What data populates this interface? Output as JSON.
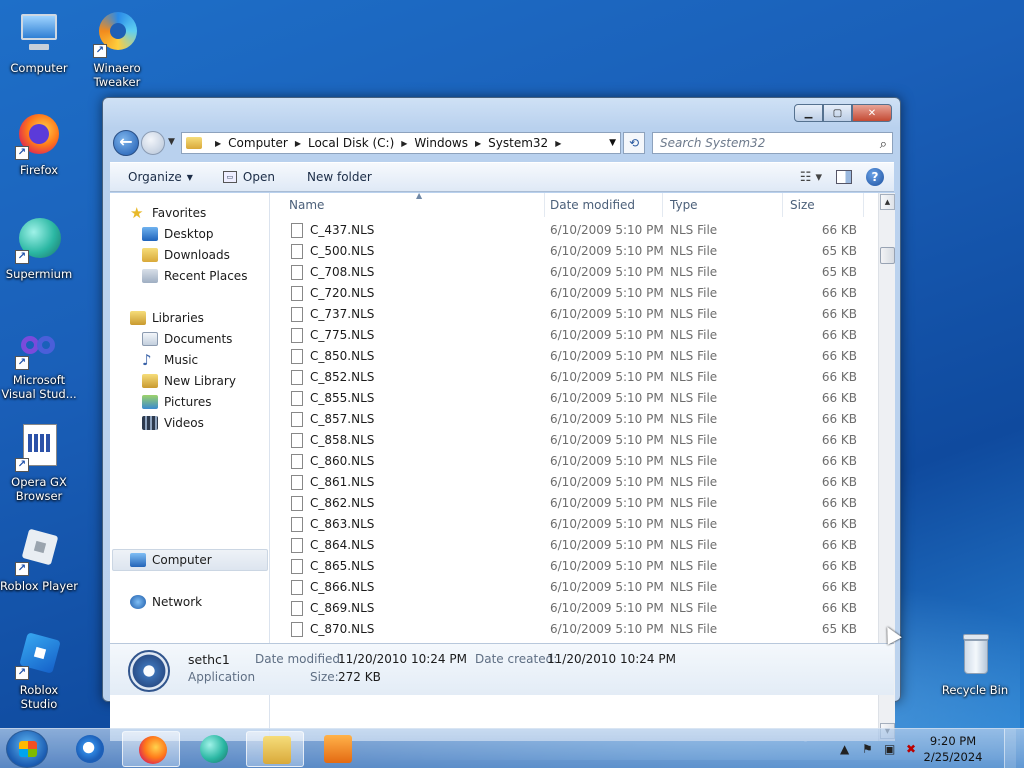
{
  "desktop": {
    "icons": [
      {
        "label": "Computer"
      },
      {
        "label": "Winaero Tweaker"
      },
      {
        "label": "Firefox"
      },
      {
        "label": "Supermium"
      },
      {
        "label": "Microsoft Visual Stud..."
      },
      {
        "label": "Opera GX Browser"
      },
      {
        "label": "Roblox Player"
      },
      {
        "label": "Roblox Studio"
      },
      {
        "label": "Recycle Bin"
      }
    ]
  },
  "window": {
    "address": {
      "crumbs": [
        "Computer",
        "Local Disk (C:)",
        "Windows",
        "System32"
      ]
    },
    "search": {
      "placeholder": "Search System32"
    },
    "toolbar": {
      "organize": "Organize",
      "open": "Open",
      "new_folder": "New folder"
    },
    "nav": {
      "favorites": "Favorites",
      "desktop": "Desktop",
      "downloads": "Downloads",
      "recent_places": "Recent Places",
      "libraries": "Libraries",
      "documents": "Documents",
      "music": "Music",
      "new_library": "New Library",
      "pictures": "Pictures",
      "videos": "Videos",
      "computer": "Computer",
      "network": "Network"
    },
    "columns": {
      "name": "Name",
      "date": "Date modified",
      "type": "Type",
      "size": "Size"
    },
    "files": [
      {
        "name": "C_437.NLS",
        "date": "6/10/2009 5:10 PM",
        "type": "NLS File",
        "size": "66 KB"
      },
      {
        "name": "C_500.NLS",
        "date": "6/10/2009 5:10 PM",
        "type": "NLS File",
        "size": "65 KB"
      },
      {
        "name": "C_708.NLS",
        "date": "6/10/2009 5:10 PM",
        "type": "NLS File",
        "size": "65 KB"
      },
      {
        "name": "C_720.NLS",
        "date": "6/10/2009 5:10 PM",
        "type": "NLS File",
        "size": "66 KB"
      },
      {
        "name": "C_737.NLS",
        "date": "6/10/2009 5:10 PM",
        "type": "NLS File",
        "size": "66 KB"
      },
      {
        "name": "C_775.NLS",
        "date": "6/10/2009 5:10 PM",
        "type": "NLS File",
        "size": "66 KB"
      },
      {
        "name": "C_850.NLS",
        "date": "6/10/2009 5:10 PM",
        "type": "NLS File",
        "size": "66 KB"
      },
      {
        "name": "C_852.NLS",
        "date": "6/10/2009 5:10 PM",
        "type": "NLS File",
        "size": "66 KB"
      },
      {
        "name": "C_855.NLS",
        "date": "6/10/2009 5:10 PM",
        "type": "NLS File",
        "size": "66 KB"
      },
      {
        "name": "C_857.NLS",
        "date": "6/10/2009 5:10 PM",
        "type": "NLS File",
        "size": "66 KB"
      },
      {
        "name": "C_858.NLS",
        "date": "6/10/2009 5:10 PM",
        "type": "NLS File",
        "size": "66 KB"
      },
      {
        "name": "C_860.NLS",
        "date": "6/10/2009 5:10 PM",
        "type": "NLS File",
        "size": "66 KB"
      },
      {
        "name": "C_861.NLS",
        "date": "6/10/2009 5:10 PM",
        "type": "NLS File",
        "size": "66 KB"
      },
      {
        "name": "C_862.NLS",
        "date": "6/10/2009 5:10 PM",
        "type": "NLS File",
        "size": "66 KB"
      },
      {
        "name": "C_863.NLS",
        "date": "6/10/2009 5:10 PM",
        "type": "NLS File",
        "size": "66 KB"
      },
      {
        "name": "C_864.NLS",
        "date": "6/10/2009 5:10 PM",
        "type": "NLS File",
        "size": "66 KB"
      },
      {
        "name": "C_865.NLS",
        "date": "6/10/2009 5:10 PM",
        "type": "NLS File",
        "size": "66 KB"
      },
      {
        "name": "C_866.NLS",
        "date": "6/10/2009 5:10 PM",
        "type": "NLS File",
        "size": "66 KB"
      },
      {
        "name": "C_869.NLS",
        "date": "6/10/2009 5:10 PM",
        "type": "NLS File",
        "size": "66 KB"
      },
      {
        "name": "C_870.NLS",
        "date": "6/10/2009 5:10 PM",
        "type": "NLS File",
        "size": "65 KB"
      }
    ],
    "details": {
      "name": "sethc1",
      "kind": "Application",
      "date_modified_label": "Date modified:",
      "date_modified": "11/20/2010 10:24 PM",
      "date_created_label": "Date created:",
      "date_created": "11/20/2010 10:24 PM",
      "size_label": "Size:",
      "size": "272 KB"
    }
  },
  "taskbar": {
    "time": "9:20 PM",
    "date": "2/25/2024"
  }
}
